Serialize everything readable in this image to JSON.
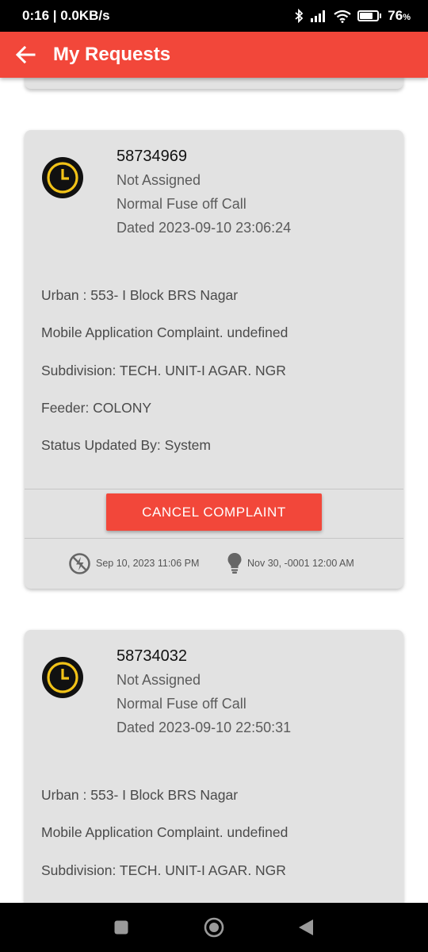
{
  "status_bar": {
    "left_text": "0:16 | 0.0KB/s",
    "battery_text": "76",
    "battery_level": 0.76,
    "icons": [
      "bluetooth-icon",
      "signal-icon",
      "wifi-icon",
      "battery-icon"
    ]
  },
  "app_bar": {
    "title": "My Requests",
    "back_icon": "arrow-left-icon"
  },
  "colors": {
    "accent": "#f2473a",
    "card_bg": "#e2e2e2",
    "clock_ring": "#f2c318"
  },
  "requests": [
    {
      "id": "58734969",
      "status": "Not Assigned",
      "type": "Normal Fuse off Call",
      "dated": "Dated 2023-09-10 23:06:24",
      "details": [
        "Urban : 553- I Block BRS Nagar",
        "Mobile Application Complaint. undefined",
        "Subdivision: TECH. UNIT-I AGAR. NGR",
        "Feeder: COLONY",
        "Status Updated By: System"
      ],
      "cancel_label": "CANCEL COMPLAINT",
      "complaint_time": "Sep 10, 2023 11:06 PM",
      "resolved_time": "Nov 30, -0001 12:00 AM"
    },
    {
      "id": "58734032",
      "status": "Not Assigned",
      "type": "Normal Fuse off Call",
      "dated": "Dated 2023-09-10 22:50:31",
      "details": [
        "Urban : 553- I Block BRS Nagar",
        "Mobile Application Complaint. undefined",
        "Subdivision: TECH. UNIT-I AGAR. NGR"
      ]
    }
  ],
  "nav_bar": {
    "icons": [
      "recents-square-icon",
      "home-circle-icon",
      "back-triangle-icon"
    ]
  }
}
